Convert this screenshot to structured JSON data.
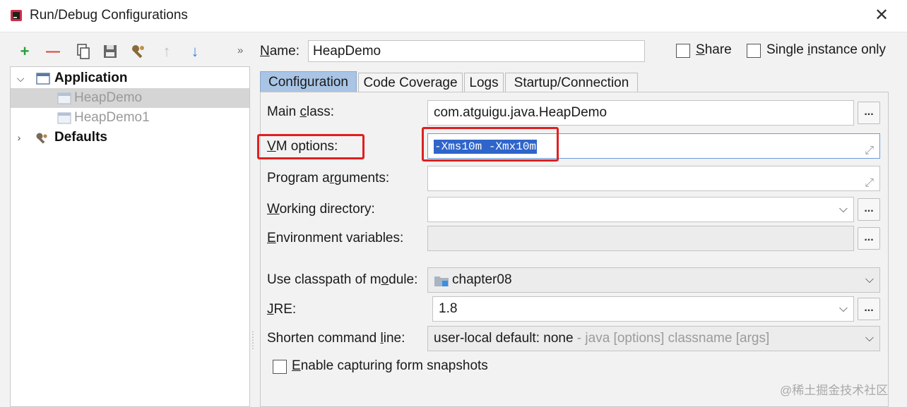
{
  "window": {
    "title": "Run/Debug Configurations"
  },
  "toolbar": {
    "buttons": [
      {
        "name": "add",
        "glyph": "+",
        "color": "#2e9c3c"
      },
      {
        "name": "remove",
        "glyph": "—",
        "color": "#d9413b"
      },
      {
        "name": "copy",
        "glyph": "⎘",
        "color": "#555555"
      },
      {
        "name": "save",
        "glyph": "▣",
        "color": "#555555"
      },
      {
        "name": "edit-defaults",
        "glyph": "⚙",
        "color": "#8a6a3a"
      },
      {
        "name": "move-up",
        "glyph": "↑",
        "color": "#b8b8b8"
      },
      {
        "name": "move-down",
        "glyph": "↓",
        "color": "#3b82d6"
      }
    ],
    "more": "»"
  },
  "tree": {
    "application": "Application",
    "items": [
      "HeapDemo",
      "HeapDemo1"
    ],
    "defaults": "Defaults"
  },
  "name": {
    "label_prefix": "N",
    "label_rest": "ame:",
    "value": "HeapDemo"
  },
  "share": {
    "u": "S",
    "rest": "hare"
  },
  "single": {
    "prefix": "Single ",
    "u": "i",
    "rest": "nstance only"
  },
  "tabs": [
    "Configuration",
    "Code Coverage",
    "Logs",
    "Startup/Connection"
  ],
  "fields": {
    "main_class": {
      "pre": "Main ",
      "u": "c",
      "post": "lass:",
      "value": "com.atguigu.java.HeapDemo"
    },
    "vm_options": {
      "u": "V",
      "post": "M options:",
      "value": "-Xms10m -Xmx10m"
    },
    "program_args": {
      "pre": "Program a",
      "u": "r",
      "post": "guments:",
      "value": ""
    },
    "working_dir": {
      "u": "W",
      "post": "orking directory:",
      "value": ""
    },
    "env_vars": {
      "u": "E",
      "post": "nvironment variables:",
      "value": ""
    },
    "classpath": {
      "pre": "Use classpath of m",
      "u": "o",
      "post": "dule:",
      "value": "chapter08"
    },
    "jre": {
      "u": "J",
      "post": "RE:",
      "value": "1.8"
    },
    "shorten": {
      "pre": "Shorten command ",
      "u": "l",
      "post": "ine:",
      "value": "user-local default: none",
      "hint": " - java [options] classname [args]"
    }
  },
  "snapshot": {
    "u": "E",
    "post": "nable capturing form snapshots"
  },
  "dots_label": "...",
  "watermark": "@稀土掘金技术社区",
  "colors": {
    "selection": "#2f65ca",
    "highlight_box": "#e02020",
    "active_tab": "#a9c4e4"
  }
}
